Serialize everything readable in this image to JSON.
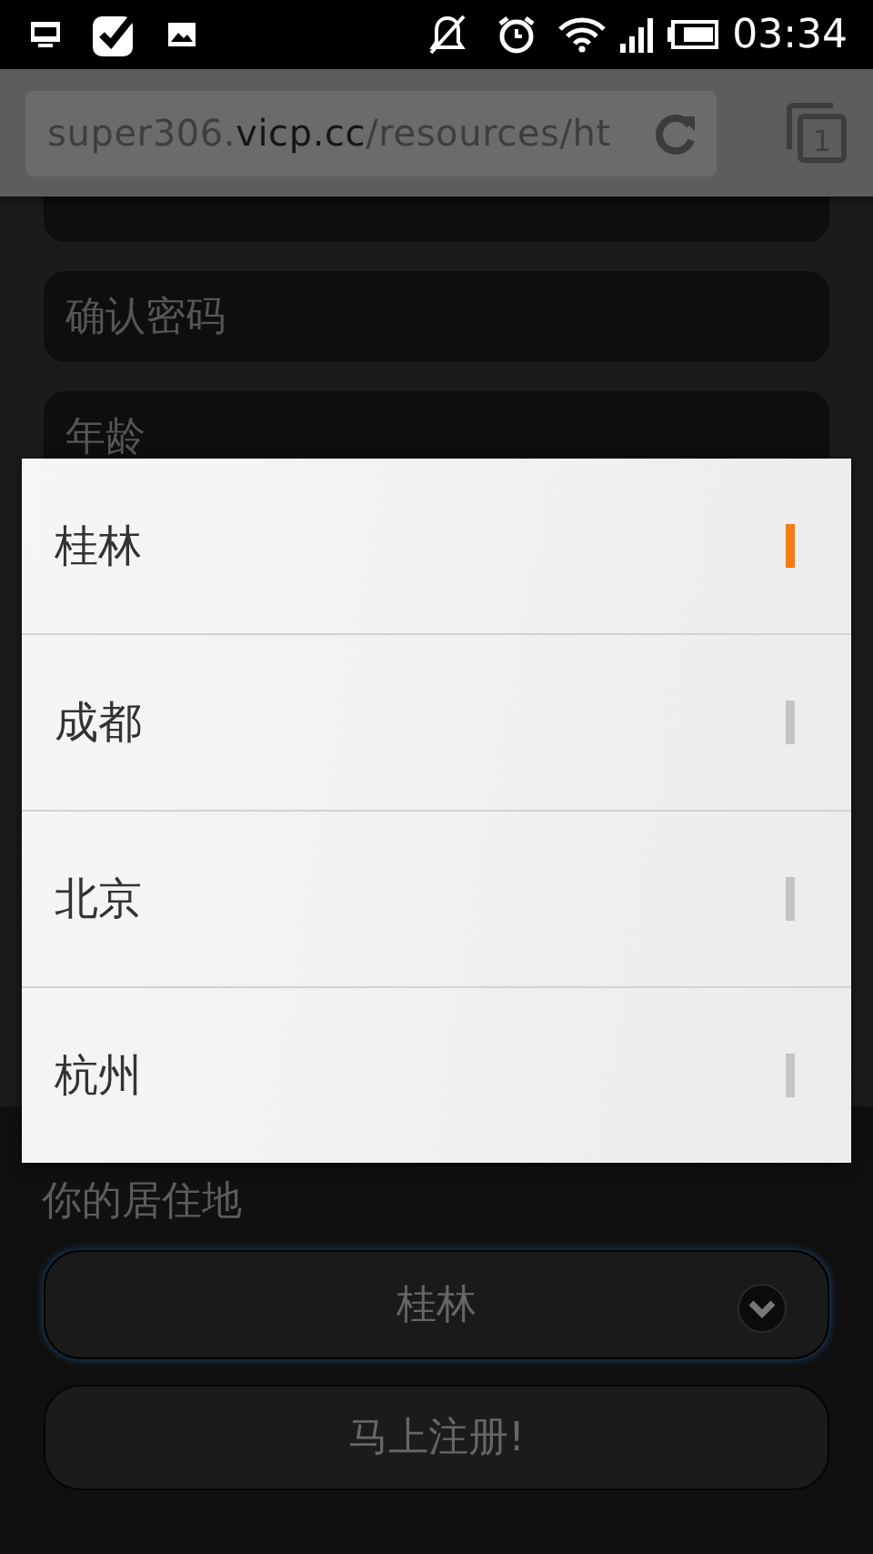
{
  "status_bar": {
    "time": "03:34"
  },
  "address_bar": {
    "url_start": "super306.",
    "url_domain": "vicp.cc",
    "url_rest": "/resources/ht",
    "tab_count": "1"
  },
  "form": {
    "fields": [
      {
        "kind": "covered"
      },
      {
        "kind": "text",
        "placeholder": "确认密码"
      },
      {
        "kind": "text",
        "placeholder": "年龄"
      }
    ],
    "residence_label": "你的居住地",
    "residence_select": {
      "value": "桂林"
    },
    "submit_button": "马上注册!"
  },
  "picker": {
    "options": [
      {
        "label": "桂林",
        "selected": true
      },
      {
        "label": "成都",
        "selected": false
      },
      {
        "label": "北京",
        "selected": false
      },
      {
        "label": "杭州",
        "selected": false
      }
    ]
  }
}
